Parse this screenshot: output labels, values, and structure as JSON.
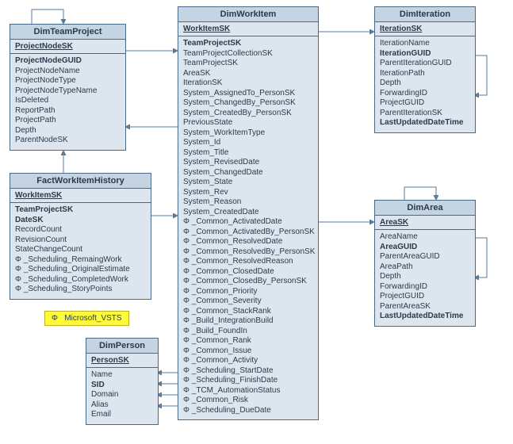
{
  "note": {
    "label": "Microsoft_VSTS",
    "bullet": "Φ"
  },
  "entities": {
    "dimTeamProject": {
      "title": "DimTeamProject",
      "pk": "ProjectNodeSK",
      "fields": [
        {
          "text": "ProjectNodeGUID",
          "bold": true
        },
        {
          "text": "ProjectNodeName"
        },
        {
          "text": "ProjectNodeType"
        },
        {
          "text": "ProjectNodeTypeName"
        },
        {
          "text": "IsDeleted"
        },
        {
          "text": "ReportPath"
        },
        {
          "text": "ProjectPath"
        },
        {
          "text": "Depth"
        },
        {
          "text": "ParentNodeSK"
        }
      ]
    },
    "factWorkItemHistory": {
      "title": "FactWorkItemHistory",
      "pk": "WorkItemSK",
      "fields": [
        {
          "text": "TeamProjectSK",
          "bold": true
        },
        {
          "text": "DateSK",
          "bold": true
        },
        {
          "text": "RecordCount"
        },
        {
          "text": "RevisionCount"
        },
        {
          "text": "StateChangeCount"
        },
        {
          "text": "Φ _Scheduling_RemaingWork"
        },
        {
          "text": "Φ _Scheduling_OriginalEstimate"
        },
        {
          "text": "Φ _Scheduling_CompletedWork"
        },
        {
          "text": "Φ _Scheduling_StoryPoints"
        }
      ]
    },
    "dimPerson": {
      "title": "DimPerson",
      "pk": "PersonSK",
      "fields": [
        {
          "text": "Name"
        },
        {
          "text": "SID",
          "bold": true
        },
        {
          "text": "Domain"
        },
        {
          "text": "Alias"
        },
        {
          "text": "Email"
        }
      ]
    },
    "dimWorkItem": {
      "title": "DimWorkItem",
      "pk": "WorkItemSK",
      "fields": [
        {
          "text": "TeamProjectSK",
          "bold": true
        },
        {
          "text": "TeamProjectCollectionSK"
        },
        {
          "text": "TeamProjectSK"
        },
        {
          "text": "AreaSK"
        },
        {
          "text": "IterationSK"
        },
        {
          "text": "System_AssignedTo_PersonSK"
        },
        {
          "text": "System_ChangedBy_PersonSK"
        },
        {
          "text": "System_CreatedBy_PersonSK"
        },
        {
          "text": "PreviousState"
        },
        {
          "text": "System_WorkItemType"
        },
        {
          "text": "System_Id"
        },
        {
          "text": "System_Title"
        },
        {
          "text": "System_RevisedDate"
        },
        {
          "text": "System_ChangedDate"
        },
        {
          "text": "System_State"
        },
        {
          "text": "System_Rev"
        },
        {
          "text": "System_Reason"
        },
        {
          "text": "System_CreatedDate"
        },
        {
          "text": "Φ _Common_ActivatedDate"
        },
        {
          "text": "Φ _Common_ActivatedBy_PersonSK"
        },
        {
          "text": "Φ _Common_ResolvedDate"
        },
        {
          "text": "Φ _Common_ResolvedBy_PersonSK"
        },
        {
          "text": "Φ _Common_ResolvedReason"
        },
        {
          "text": "Φ _Common_ClosedDate"
        },
        {
          "text": "Φ _Common_ClosedBy_PersonSK"
        },
        {
          "text": "Φ _Common_Priority"
        },
        {
          "text": "Φ _Common_Severity"
        },
        {
          "text": "Φ _Common_StackRank"
        },
        {
          "text": "Φ _Build_IntegrationBuild"
        },
        {
          "text": "Φ _Build_FoundIn"
        },
        {
          "text": "Φ _Common_Rank"
        },
        {
          "text": "Φ _Common_Issue"
        },
        {
          "text": "Φ _Common_Activity"
        },
        {
          "text": "Φ _Scheduling_StartDate"
        },
        {
          "text": "Φ _Scheduling_FinishDate"
        },
        {
          "text": "Φ _TCM_AutomationStatus"
        },
        {
          "text": "Φ _Common_Risk"
        },
        {
          "text": "Φ _Scheduling_DueDate"
        }
      ]
    },
    "dimIteration": {
      "title": "DimIteration",
      "pk": "IterationSK",
      "fields": [
        {
          "text": "IterationName"
        },
        {
          "text": "IterationGUID",
          "bold": true
        },
        {
          "text": "ParentIterationGUID"
        },
        {
          "text": "IterationPath"
        },
        {
          "text": "Depth"
        },
        {
          "text": "ForwardingID"
        },
        {
          "text": "ProjectGUID"
        },
        {
          "text": "ParentIterationSK"
        },
        {
          "text": "LastUpdatedDateTime",
          "bold": true
        }
      ]
    },
    "dimArea": {
      "title": "DimArea",
      "pk": "AreaSK",
      "fields": [
        {
          "text": "AreaName"
        },
        {
          "text": "AreaGUID",
          "bold": true
        },
        {
          "text": "ParentAreaGUID"
        },
        {
          "text": "AreaPath"
        },
        {
          "text": "Depth"
        },
        {
          "text": "ForwardingID"
        },
        {
          "text": "ProjectGUID"
        },
        {
          "text": "ParentAreaSK"
        },
        {
          "text": "LastUpdatedDateTime",
          "bold": true
        }
      ]
    }
  }
}
